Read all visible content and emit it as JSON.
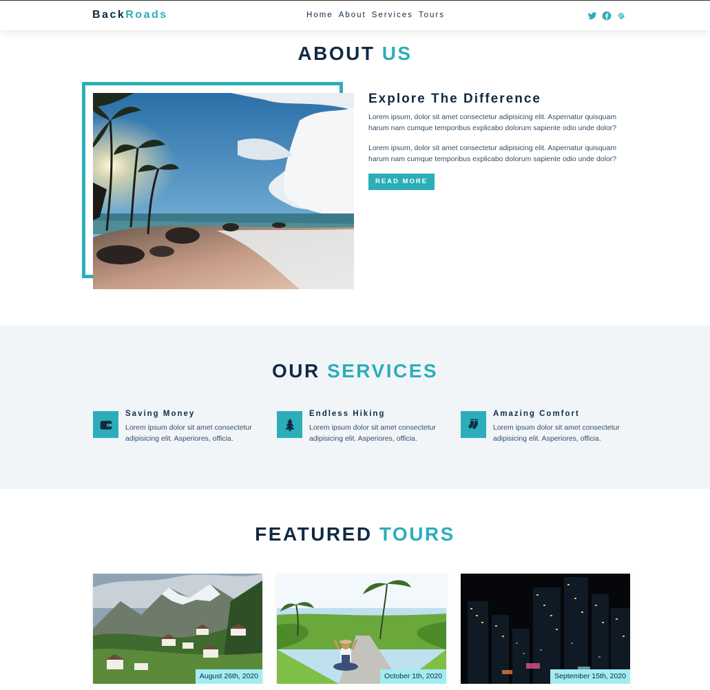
{
  "nav": {
    "logo_part1": "Back",
    "logo_part2": "Roads",
    "links": [
      "Home",
      "About",
      "Services",
      "Tours"
    ],
    "social_icons": [
      "twitter-icon",
      "facebook-icon",
      "squarespace-icon"
    ]
  },
  "about": {
    "title_part1": "ABOUT",
    "title_part2": "US",
    "heading": "Explore The Difference",
    "para1": "Lorem ipsum, dolor sit amet consectetur adipisicing elit. Aspernatur quisquam harum nam cumque temporibus explicabo dolorum sapiente odio unde dolor?",
    "para2": "Lorem ipsum, dolor sit amet consectetur adipisicing elit. Aspernatur quisquam harum nam cumque temporibus explicabo dolorum sapiente odio unde dolor?",
    "button_label": "READ MORE"
  },
  "services": {
    "title_part1": "OUR",
    "title_part2": "SERVICES",
    "items": [
      {
        "title": "Saving Money",
        "text": "Lorem ipsum dolor sit amet consectetur adipisicing elit. Asperiores, officia.",
        "icon": "wallet-icon"
      },
      {
        "title": "Endless Hiking",
        "text": "Lorem ipsum dolor sit amet consectetur adipisicing elit. Asperiores, officia.",
        "icon": "tree-icon"
      },
      {
        "title": "Amazing Comfort",
        "text": "Lorem ipsum dolor sit amet consectetur adipisicing elit. Asperiores, officia.",
        "icon": "socks-icon"
      }
    ]
  },
  "tours": {
    "title_part1": "FEATURED",
    "title_part2": "TOURS",
    "items": [
      {
        "date": "August 26th, 2020"
      },
      {
        "date": "October 1th, 2020"
      },
      {
        "date": "September 15th, 2020"
      }
    ]
  },
  "colors": {
    "primary": "#2caeba",
    "dark": "#102a42",
    "light_bg": "#f1f5f8",
    "date_badge": "#a2ecf2"
  }
}
